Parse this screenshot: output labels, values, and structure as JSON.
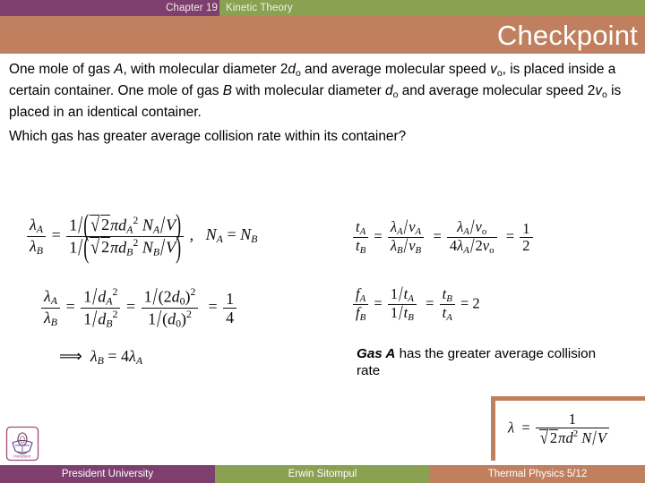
{
  "header": {
    "chapter_label": "Chapter 19",
    "chapter_topic": "Kinetic Theory",
    "title": "Checkpoint",
    "purple": "#7e3f6e",
    "green": "#89a151",
    "salmon": "#c0805f"
  },
  "body": {
    "paragraph_1_parts": {
      "t1": "One mole of gas ",
      "v1": "A",
      "t2": ", with molecular diameter 2",
      "v2": "d",
      "s2": "o",
      "t3": " and average molecular speed ",
      "v3": "v",
      "s3": "o",
      "t4": ", is placed inside a certain container. One mole of gas ",
      "v4": "B",
      "t5": " with molecular diameter ",
      "v5": "d",
      "s5": "o",
      "t6": " and average molecular speed 2",
      "v6": "v",
      "s6": "o",
      "t7": " is placed in an identical container."
    },
    "paragraph_2": "Which gas has greater average collision rate within its container?"
  },
  "equations": {
    "eq1": {
      "lhs_num": "λ",
      "lhs_num_sub": "A",
      "lhs_den": "λ",
      "lhs_den_sub": "B",
      "eq": "=",
      "rhs_num": "1/(√2πd_A² N_A/V)",
      "rhs_den": "1/(√2πd_B² N_B/V)",
      "comma": ",",
      "note": "N_A = N_B",
      "plain": "λA/λB = [1/(√2 π d_A^2 N_A/V)] / [1/(√2 π d_B^2 N_B/V)],  N_A = N_B"
    },
    "eq2": {
      "plain": "λA/λB = (1/d_A^2)/(1/d_B^2) = (1/(2d_0)^2)/(1/(d_0)^2) = 1/4",
      "result": "1/4"
    },
    "eq3": {
      "plain": "⟹ λ_B = 4λ_A",
      "coefficient": "4"
    },
    "eq4": {
      "plain": "t_A/t_B = (λ_A/v_A)/(λ_B/v_B) = (λ_A/v_o)/(4λ_A/2v_o) = 1/2",
      "result": "1/2"
    },
    "eq5": {
      "plain": "f_A/f_B = (1/t_A)/(1/t_B) = t_B/t_A = 2",
      "result": "2"
    }
  },
  "answer": {
    "bold_part": "Gas A",
    "rest": " has the greater average collision rate"
  },
  "formula_box": {
    "plain": "λ = 1 / (√2 π d² N/V)",
    "lhs": "λ",
    "eq": "=",
    "numerator": "1",
    "denominator": "√2πd² N/V",
    "accent_color": "#c0805f"
  },
  "footer": {
    "left": "President University",
    "middle": "Erwin Sitompul",
    "right": "Thermal Physics 5/12"
  }
}
